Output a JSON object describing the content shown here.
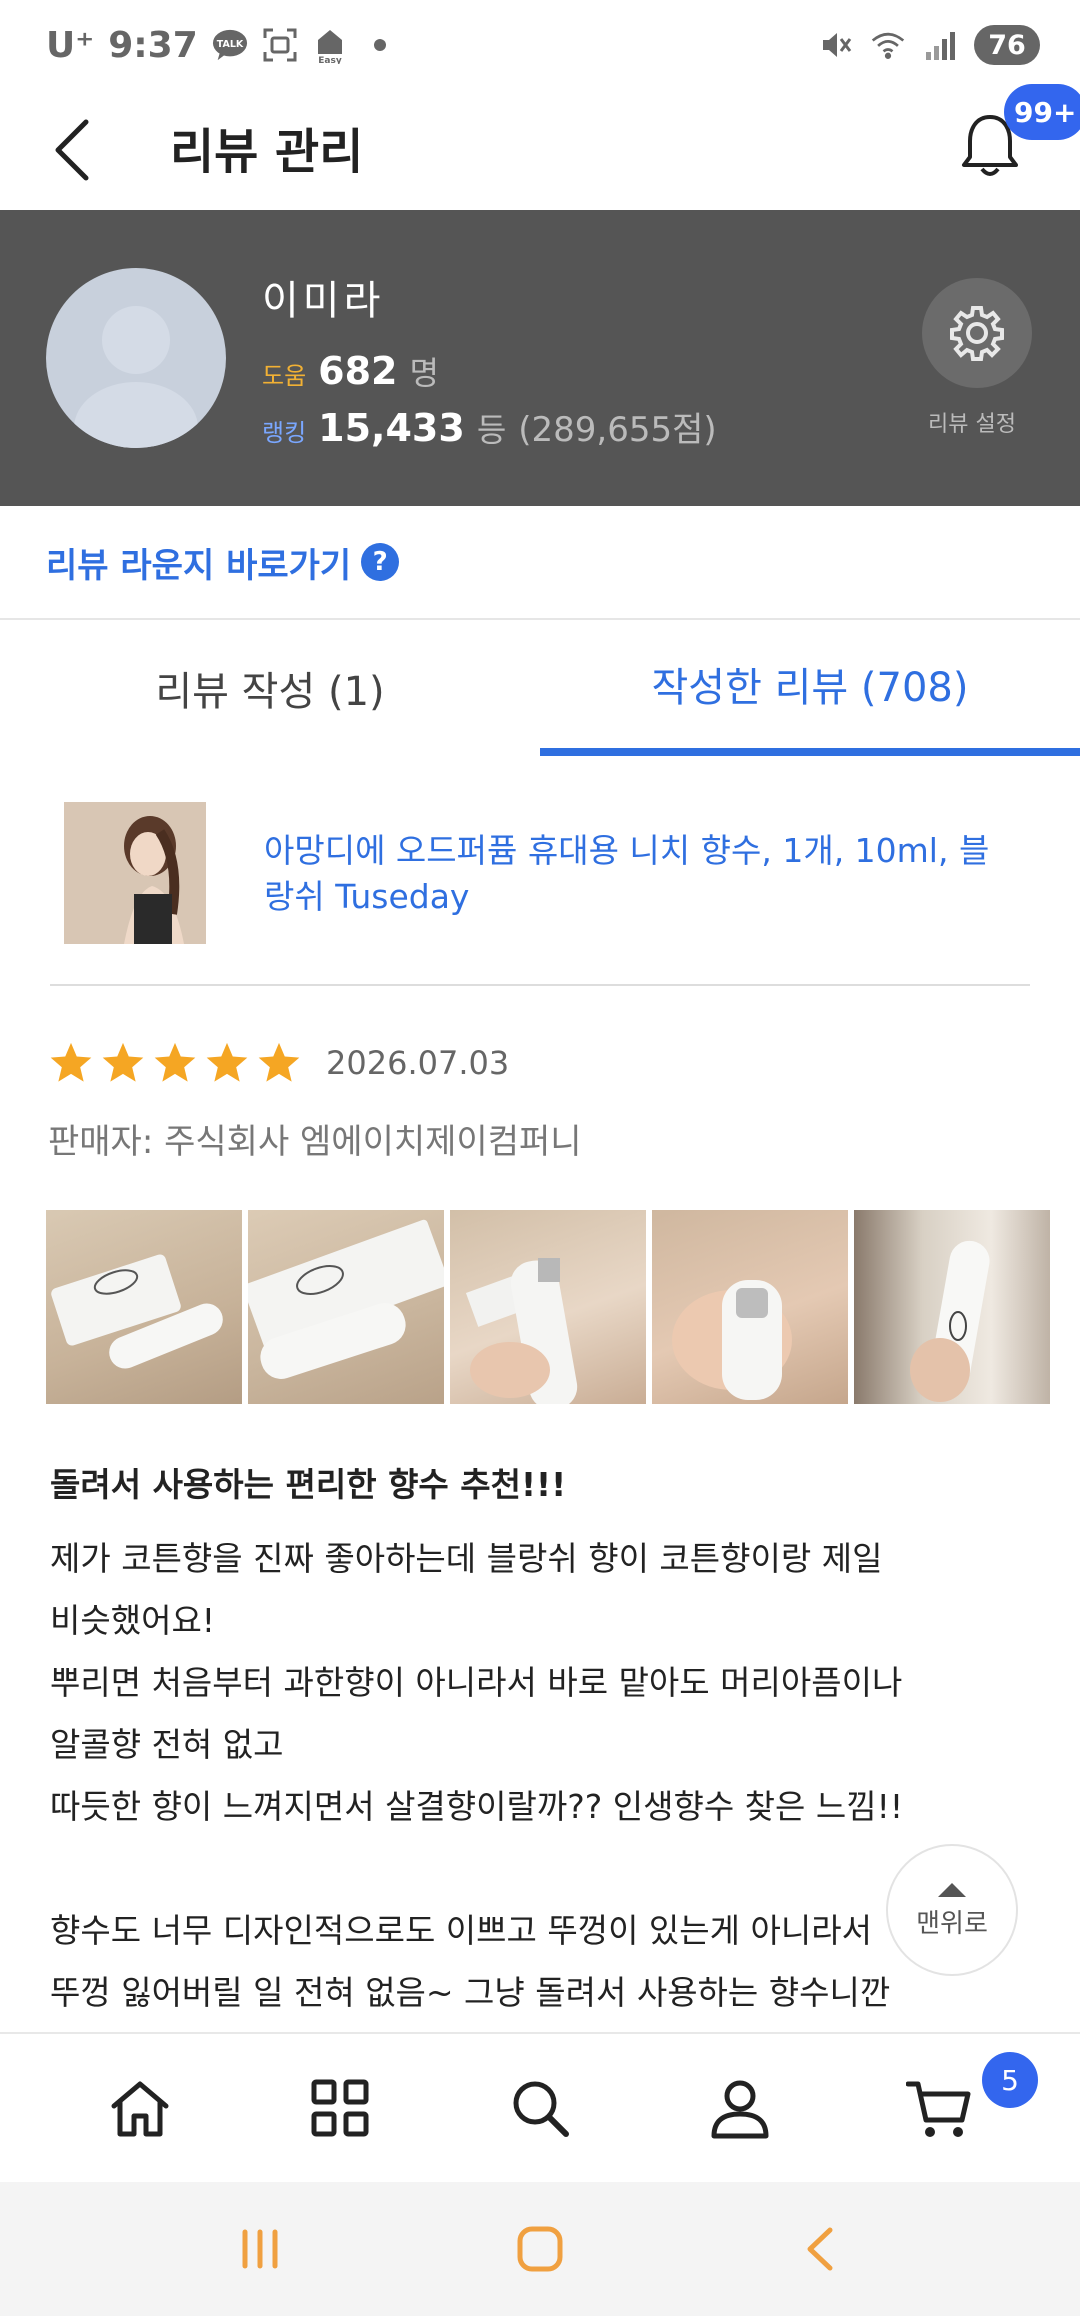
{
  "status_bar": {
    "carrier": "U⁺",
    "time": "9:37",
    "talk_label": "TALK",
    "easy_label": "Easy",
    "battery": "76"
  },
  "header": {
    "title": "리뷰 관리",
    "notification_count": "99+"
  },
  "profile": {
    "name": "이미라",
    "help_label": "도움",
    "help_count": "682",
    "help_unit": "명",
    "rank_label": "랭킹",
    "rank_value": "15,433",
    "rank_unit": "등",
    "rank_points": "(289,655점)",
    "settings_label": "리뷰 설정"
  },
  "lounge": {
    "label": "리뷰 라운지 바로가기",
    "help_icon": "?"
  },
  "tabs": [
    {
      "label": "리뷰 작성 (1)",
      "active": false
    },
    {
      "label": "작성한 리뷰 (708)",
      "active": true
    }
  ],
  "product": {
    "title": "아망디에 오드퍼퓸 휴대용 니치 향수, 1개, 10ml, 블랑쉬 Tuseday"
  },
  "review": {
    "rating": 5,
    "date": "2026.07.03",
    "seller": "판매자: 주식회사 엠에이치제이컴퍼니",
    "photo_count": 5,
    "title": "돌려서 사용하는 편리한 향수 추천!!!",
    "body_lines": [
      "제가 코튼향을 진짜 좋아하는데 블랑쉬 향이 코튼향이랑 제일",
      "비슷했어요!",
      "뿌리면 처음부터 과한향이 아니라서 바로 맡아도 머리아픔이나",
      "알콜향 전혀 없고",
      "따듯한 향이 느껴지면서 살결향이랄까?? 인생향수 찾은 느낌!!",
      "",
      "향수도 너무 디자인적으로도 이쁘고 뚜껑이 있는게 아니라서",
      "뚜껑 잃어버릴 일 전혀 없음~ 그냥 돌려서 사용하는 향수니깐"
    ]
  },
  "to_top_label": "맨위로",
  "bottom_nav": {
    "items": [
      "home-icon",
      "category-icon",
      "search-icon",
      "my-page-icon",
      "cart-icon"
    ],
    "cart_count": "5"
  },
  "colors": {
    "accent": "#2f6fe0",
    "badge": "#3366ee",
    "star": "#f5a623",
    "profile_bg": "#555555"
  }
}
